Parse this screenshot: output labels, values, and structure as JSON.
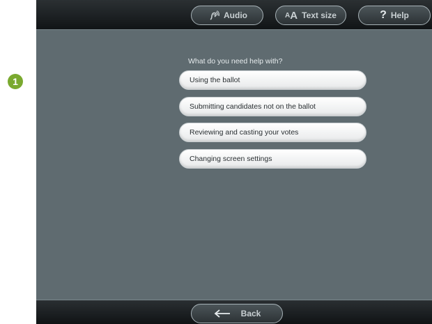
{
  "marker": {
    "label": "1"
  },
  "header": {
    "audio_label": "Audio",
    "textsize_small": "A",
    "textsize_big": "A",
    "textsize_label": "Text size",
    "help_glyph": "?",
    "help_label": "Help"
  },
  "main": {
    "prompt": "What do you need help with?",
    "options": [
      {
        "label": "Using the ballot"
      },
      {
        "label": "Submitting candidates not on the ballot"
      },
      {
        "label": "Reviewing and casting your votes"
      },
      {
        "label": "Changing screen settings"
      }
    ]
  },
  "footer": {
    "back_label": "Back"
  },
  "icons": {
    "audio": "hearing-icon",
    "textsize": "text-size-icon",
    "help": "question-icon",
    "back": "left-arrow-icon"
  },
  "colors": {
    "screen_background": "#5f6b70",
    "bar_background": "#1a1e20",
    "option_background": "#ffffff",
    "marker": "#7aa92f"
  }
}
